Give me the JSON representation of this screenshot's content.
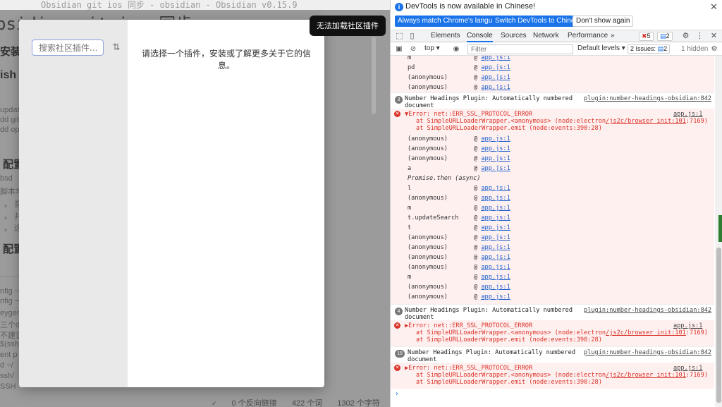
{
  "obsidian": {
    "title_bar": "Obsidian git ios 同步 - obsidian - Obsidian v0.15.9",
    "heading": "bsidian git ios 同步",
    "bg_lines": [
      "安装",
      "ish",
      "update",
      "dd git",
      "dd op",
      "配置",
      "bsd",
      "脚本地",
      "。  音",
      "。  并",
      "。  这",
      "配置",
      "nfig ~",
      "nfig ~",
      "eygen",
      "三个d",
      "不建议",
      "$(ssh-",
      "ent p",
      "d ~/",
      "ssh/",
      "SSH"
    ],
    "status_bar": [
      "0 个反向链接",
      "422 个词",
      "1302 个字符"
    ]
  },
  "modal": {
    "search_placeholder": "搜索社区插件...",
    "sort_icon": "sort-icon",
    "message": "请选择一个插件，安装或了解更多关于它的信息。"
  },
  "toast": {
    "text": "无法加载社区插件"
  },
  "devtools": {
    "infobar": {
      "text": "DevTools is now available in Chinese!",
      "btn_match": "Always match Chrome's language",
      "btn_switch": "Switch DevTools to Chinese",
      "btn_dont": "Don't show again"
    },
    "tabs": [
      "Elements",
      "Console",
      "Sources",
      "Network",
      "Performance"
    ],
    "more_tabs": "»",
    "error_count": "5",
    "issue_count": "2",
    "toolbar": {
      "context": "top",
      "filter_placeholder": "Filter",
      "levels": "Default levels",
      "issues": "2 Issues:",
      "issues_badge": "2",
      "hidden": "1 hidden"
    },
    "console": {
      "top_frames": [
        {
          "fn": "m",
          "src": "app.js:1"
        },
        {
          "fn": "pd",
          "src": "app.js:1"
        },
        {
          "fn": "(anonymous)",
          "src": "app.js:1"
        },
        {
          "fn": "(anonymous)",
          "src": "app.js:1"
        }
      ],
      "log1": {
        "count": "3",
        "msg1": "Number Headings Plugin: Automatically numbered",
        "msg2": "document",
        "src": "plugin:number-headings-obsidian:842"
      },
      "err1": {
        "msg": "▼Error: net::ERR_SSL_PROTOCOL_ERROR",
        "src": "app.js:1",
        "stack1a": "at SimpleURLLoaderWrapper.<anonymous> (node:electron",
        "stack1b": "/js2c/browser_init:101",
        "stack1c": ":7169)",
        "stack2": "at SimpleURLLoaderWrapper.emit (node:events:390:28)",
        "frames": [
          {
            "fn": "(anonymous)",
            "src": "app.js:1"
          },
          {
            "fn": "(anonymous)",
            "src": "app.js:1"
          },
          {
            "fn": "(anonymous)",
            "src": "app.js:1"
          },
          {
            "fn": "a",
            "src": "app.js:1"
          },
          {
            "fn": "Promise.then (async)",
            "src": ""
          },
          {
            "fn": "l",
            "src": "app.js:1"
          },
          {
            "fn": "(anonymous)",
            "src": "app.js:1"
          },
          {
            "fn": "m",
            "src": "app.js:1"
          },
          {
            "fn": "t.updateSearch",
            "src": "app.js:1"
          },
          {
            "fn": "t",
            "src": "app.js:1"
          },
          {
            "fn": "(anonymous)",
            "src": "app.js:1"
          },
          {
            "fn": "(anonymous)",
            "src": "app.js:1"
          },
          {
            "fn": "(anonymous)",
            "src": "app.js:1"
          },
          {
            "fn": "(anonymous)",
            "src": "app.js:1"
          },
          {
            "fn": "m",
            "src": "app.js:1"
          },
          {
            "fn": "(anonymous)",
            "src": "app.js:1"
          },
          {
            "fn": "(anonymous)",
            "src": "app.js:1"
          }
        ]
      },
      "log2": {
        "count": "4",
        "msg1": "Number Headings Plugin: Automatically numbered",
        "msg2": "document",
        "src": "plugin:number-headings-obsidian:842"
      },
      "err2": {
        "msg": "▶Error: net::ERR_SSL_PROTOCOL_ERROR",
        "src": "app.js:1"
      },
      "log3": {
        "count": "15",
        "msg1": "Number Headings Plugin: Automatically numbered",
        "msg2": "document",
        "src": "plugin:number-headings-obsidian:842"
      },
      "err3": {
        "msg": "▶Error: net::ERR_SSL_PROTOCOL_ERROR",
        "src": "app.js:1"
      },
      "prompt": "›"
    }
  }
}
